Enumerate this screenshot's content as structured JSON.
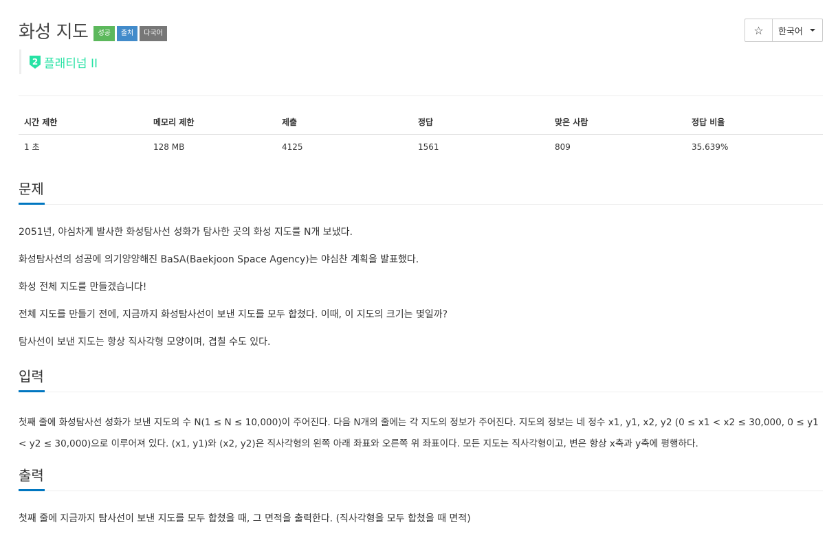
{
  "problem": {
    "title": "화성 지도",
    "badges": [
      "성공",
      "출처",
      "다국어"
    ],
    "tier": "플래티넘 II",
    "tier_icon": "platinum-2-badge-icon",
    "tier_color": "#27e2a4"
  },
  "controls": {
    "star_icon": "star-icon",
    "star_glyph": "☆",
    "language": "한국어"
  },
  "stats": {
    "headers": [
      "시간 제한",
      "메모리 제한",
      "제출",
      "정답",
      "맞은 사람",
      "정답 비율"
    ],
    "values": [
      "1 초",
      "128 MB",
      "4125",
      "1561",
      "809",
      "35.639%"
    ]
  },
  "sections": {
    "problem": {
      "heading": "문제",
      "paragraphs": [
        "2051년, 야심차게 발사한 화성탐사선 성화가 탐사한 곳의 화성 지도를 N개 보냈다.",
        "화성탐사선의 성공에 의기양양해진 BaSA(Baekjoon Space Agency)는 야심찬 계획을 발표했다.",
        "화성 전체 지도를 만들겠습니다!",
        "전체 지도를 만들기 전에, 지금까지 화성탐사선이 보낸 지도를 모두 합쳤다. 이때, 이 지도의 크기는 몇일까?",
        "탐사선이 보낸 지도는 항상 직사각형 모양이며, 겹칠 수도 있다."
      ]
    },
    "input": {
      "heading": "입력",
      "text": "첫째 줄에 화성탐사선 성화가 보낸 지도의 수 N(1 ≤ N ≤ 10,000)이 주어진다. 다음 N개의 줄에는 각 지도의 정보가 주어진다. 지도의 정보는 네 정수 x1, y1, x2, y2 (0 ≤ x1 < x2 ≤ 30,000, 0 ≤ y1 < y2 ≤ 30,000)으로 이루어져 있다. (x1, y1)와 (x2, y2)은 직사각형의 왼쪽 아래 좌표와 오른쪽 위 좌표이다. 모든 지도는 직사각형이고, 변은 항상 x축과 y축에 평행하다."
    },
    "output": {
      "heading": "출력",
      "text": "첫째 줄에 지금까지 탐사선이 보낸 지도를 모두 합쳤을 때, 그 면적을 출력한다. (직사각형을 모두 합쳤을 때 면적)"
    }
  }
}
